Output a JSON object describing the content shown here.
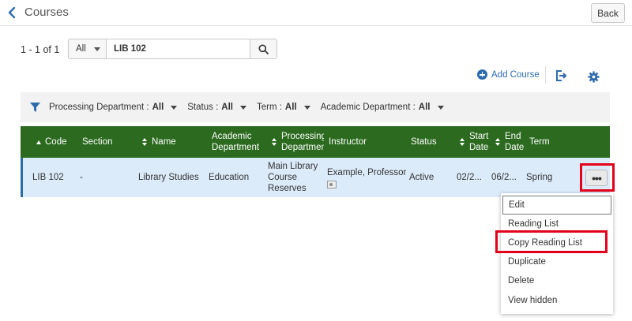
{
  "header": {
    "title": "Courses",
    "back_label": "Back"
  },
  "search": {
    "count": "1 - 1 of 1",
    "scope": "All",
    "value": "LIB 102"
  },
  "toolbar": {
    "add_course_label": "Add Course"
  },
  "filters": [
    {
      "label": "Processing Department :",
      "value": "All"
    },
    {
      "label": "Status :",
      "value": "All"
    },
    {
      "label": "Term :",
      "value": "All"
    },
    {
      "label": "Academic Department :",
      "value": "All"
    }
  ],
  "table": {
    "columns": {
      "code": "Code",
      "section": "Section",
      "name": "Name",
      "academic_department": "Academic Department",
      "processing_department": "Processing Departmen",
      "instructor": "Instructor",
      "status": "Status",
      "start_date": "Start Date",
      "end_date": "End Date",
      "term": "Term"
    },
    "row": {
      "code": "LIB 102",
      "section": "-",
      "name": "Library Studies",
      "academic_department": "Education",
      "processing_department": "Main Library Course Reserves",
      "instructor": "Example, Professor",
      "status": "Active",
      "start_date": "02/2...",
      "end_date": "06/2...",
      "term": "Spring"
    },
    "row_actions_label": "•••"
  },
  "menu": {
    "items": [
      "Edit",
      "Reading List",
      "Copy Reading List",
      "Duplicate",
      "Delete",
      "View hidden"
    ]
  },
  "colors": {
    "header_green": "#2b6a1f",
    "row_selected": "#dcebfa",
    "link_blue": "#2d6bad",
    "highlight_red": "#e3001b"
  }
}
